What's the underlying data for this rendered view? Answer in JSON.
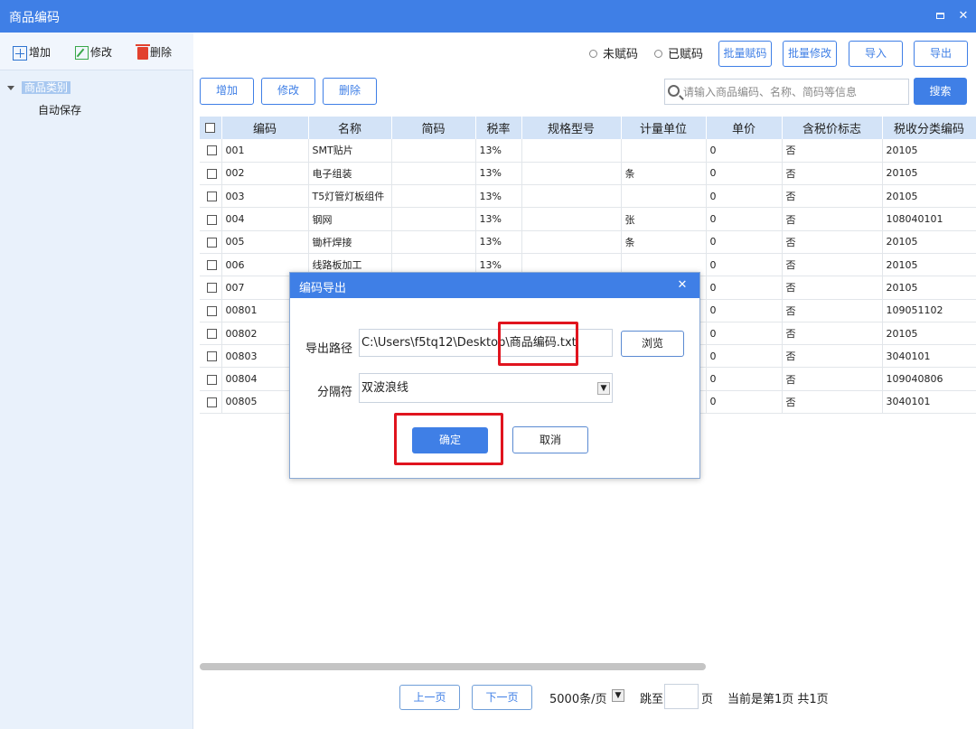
{
  "window": {
    "title": "商品编码"
  },
  "sidebar": {
    "toolbar": {
      "add": "增加",
      "edit": "修改",
      "delete": "删除"
    },
    "tree": {
      "root": "商品类别",
      "child": "自动保存"
    }
  },
  "filters": {
    "unassigned": "未赋码",
    "assigned": "已赋码"
  },
  "toolbar": {
    "batch_assign": "批量赋码",
    "batch_edit": "批量修改",
    "import": "导入",
    "export": "导出",
    "add": "增加",
    "edit": "修改",
    "delete": "删除"
  },
  "search": {
    "placeholder": "请输入商品编码、名称、简码等信息",
    "button": "搜索"
  },
  "table": {
    "headers": [
      "编码",
      "名称",
      "简码",
      "税率",
      "规格型号",
      "计量单位",
      "单价",
      "含税价标志",
      "税收分类编码"
    ],
    "rows": [
      {
        "code": "001",
        "name": "SMT贴片",
        "short": "",
        "rate": "13%",
        "spec": "",
        "unit": "",
        "price": "0",
        "taxflag": "否",
        "taxcode": "20105"
      },
      {
        "code": "002",
        "name": "电子组装",
        "short": "",
        "rate": "13%",
        "spec": "",
        "unit": "条",
        "price": "0",
        "taxflag": "否",
        "taxcode": "20105"
      },
      {
        "code": "003",
        "name": "T5灯管灯板组件",
        "short": "",
        "rate": "13%",
        "spec": "",
        "unit": "",
        "price": "0",
        "taxflag": "否",
        "taxcode": "20105"
      },
      {
        "code": "004",
        "name": "钢网",
        "short": "",
        "rate": "13%",
        "spec": "",
        "unit": "张",
        "price": "0",
        "taxflag": "否",
        "taxcode": "108040101"
      },
      {
        "code": "005",
        "name": "锄杆焊接",
        "short": "",
        "rate": "13%",
        "spec": "",
        "unit": "条",
        "price": "0",
        "taxflag": "否",
        "taxcode": "20105"
      },
      {
        "code": "006",
        "name": "线路板加工",
        "short": "",
        "rate": "13%",
        "spec": "",
        "unit": "",
        "price": "0",
        "taxflag": "否",
        "taxcode": "20105"
      },
      {
        "code": "007",
        "name": "",
        "short": "",
        "rate": "",
        "spec": "",
        "unit": "",
        "price": "0",
        "taxflag": "否",
        "taxcode": "20105"
      },
      {
        "code": "00801",
        "name": "",
        "short": "",
        "rate": "",
        "spec": "",
        "unit": "",
        "price": "0",
        "taxflag": "否",
        "taxcode": "109051102"
      },
      {
        "code": "00802",
        "name": "",
        "short": "",
        "rate": "",
        "spec": "",
        "unit": "",
        "price": "0",
        "taxflag": "否",
        "taxcode": "20105"
      },
      {
        "code": "00803",
        "name": "",
        "short": "",
        "rate": "",
        "spec": "",
        "unit": "",
        "price": "0",
        "taxflag": "否",
        "taxcode": "3040101"
      },
      {
        "code": "00804",
        "name": "",
        "short": "",
        "rate": "",
        "spec": "",
        "unit": "",
        "price": "0",
        "taxflag": "否",
        "taxcode": "109040806"
      },
      {
        "code": "00805",
        "name": "",
        "short": "",
        "rate": "",
        "spec": "",
        "unit": "",
        "price": "0",
        "taxflag": "否",
        "taxcode": "3040101"
      }
    ]
  },
  "pager": {
    "prev": "上一页",
    "next": "下一页",
    "page_size": "5000条/页",
    "goto_prefix": "跳至",
    "goto_suffix": "页",
    "status": "当前是第1页 共1页"
  },
  "dialog": {
    "title": "编码导出",
    "path_label": "导出路径",
    "path_value": "C:\\Users\\f5tq12\\Desktop\\商品编码.txt",
    "browse": "浏览",
    "sep_label": "分隔符",
    "sep_value": "双波浪线",
    "ok": "确定",
    "cancel": "取消"
  },
  "colors": {
    "accent": "#3f7fe6",
    "highlight": "#e0141e",
    "header_bg": "#d3e3f7",
    "sidebar_bg": "#e9f1fb"
  }
}
